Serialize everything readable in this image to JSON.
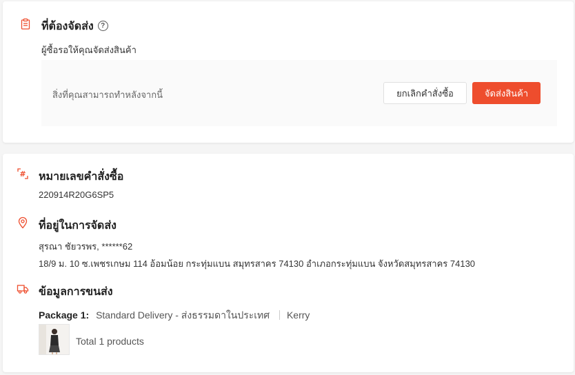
{
  "to_ship": {
    "title": "ที่ต้องจัดส่ง",
    "help_icon": "?",
    "subtitle": "ผู้ซื้อรอให้คุณจัดส่งสินค้า",
    "action_prompt": "สิ่งที่คุณสามารถทำหลังจากนี้",
    "cancel_button": "ยกเลิกคำสั่งซื้อ",
    "ship_button": "จัดส่งสินค้า",
    "accent_color": "#ee4d2d"
  },
  "order": {
    "title": "หมายเลขคำสั่งซื้อ",
    "number": "220914R20G6SP5"
  },
  "address": {
    "title": "ที่อยู่ในการจัดส่ง",
    "recipient": "สุรณา ชัยวรพร, ******62",
    "full_address": "18/9 ม. 10 ซ.เพชรเกษม 114 อ้อมน้อย กระทุ่มแบน สมุทรสาคร 74130 อำเภอกระทุ่มแบน จังหวัดสมุทรสาคร 74130"
  },
  "shipping": {
    "title": "ข้อมูลการขนส่ง",
    "package_label": "Package 1:",
    "delivery_method": "Standard Delivery - ส่งธรรมดาในประเทศ",
    "carrier": "Kerry",
    "total_products": "Total 1 products"
  }
}
